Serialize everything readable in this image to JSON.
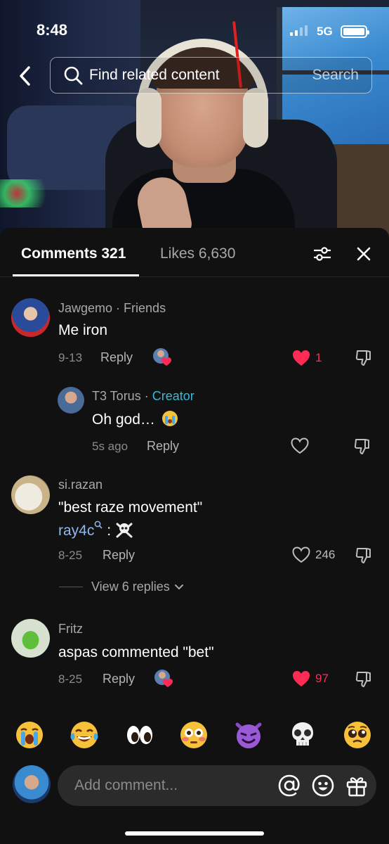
{
  "status_bar": {
    "time": "8:48",
    "network": "5G"
  },
  "search": {
    "query": "Find related content",
    "button": "Search"
  },
  "tabs": {
    "comments": "Comments 321",
    "likes": "Likes 6,630"
  },
  "comments": [
    {
      "author": "Jawgemo",
      "relation": " · Friends",
      "text": "Me iron",
      "date": "9-13",
      "reply": "Reply",
      "likes": "1",
      "liked": true
    },
    {
      "author": "T3 Torus",
      "separator": " · ",
      "badge": "Creator",
      "text": "Oh god…",
      "date": "5s ago",
      "reply": "Reply",
      "likes": "",
      "liked": false
    },
    {
      "author": "si.razan",
      "text": "\"best raze movement\"",
      "mention": "ray4c",
      "mention_suffix": " : ",
      "date": "8-25",
      "reply": "Reply",
      "likes": "246",
      "liked": false,
      "view_replies": "View 6 replies"
    },
    {
      "author": "Fritz",
      "text": "aspas commented \"bet\"",
      "date": "8-25",
      "reply": "Reply",
      "likes": "97",
      "liked": true
    }
  ],
  "emoji_bar": [
    "loudly-crying-face",
    "tears-of-joy-face",
    "eyes",
    "flushed-face",
    "smiling-imp",
    "skull",
    "pleading-face"
  ],
  "input": {
    "placeholder": "Add comment..."
  },
  "colors": {
    "sheet_bg": "#111111",
    "like_red": "#fe2c55",
    "creator_blue": "#3ab8d8"
  }
}
